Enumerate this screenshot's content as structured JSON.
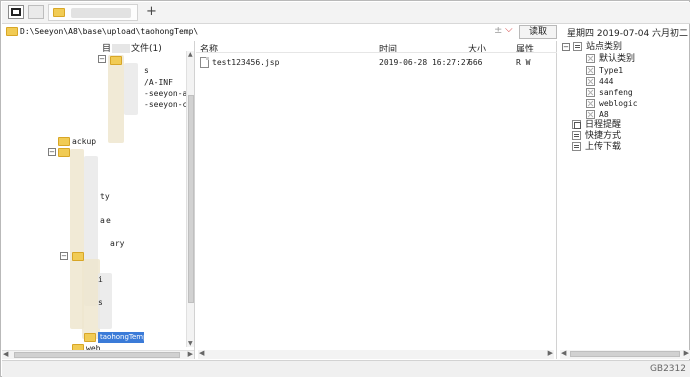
{
  "tabbar": {
    "add_label": "+"
  },
  "address": {
    "path": "D:\\Seeyon\\A8\\base\\upload\\taohongTemp\\",
    "plus": "±",
    "read_button": "读取"
  },
  "datebar": {
    "text": "星期四  2019-07-04  六月初二"
  },
  "tree": {
    "header": {
      "prefix": "目",
      "suffix": "文件(1)"
    },
    "labels": {
      "n1": "s",
      "n2": "/A-INF",
      "n3": "-seeyon-apps-",
      "n4": "-seeyon-ctp-f",
      "n5": "ackup",
      "n6": "ty",
      "n7": "a",
      "n8": "e",
      "n9": "ary",
      "n10": "i",
      "n11": "s",
      "selected": "taohongTemp",
      "last": "web"
    }
  },
  "files": {
    "headers": {
      "name": "名称",
      "time": "时间",
      "size": "大小",
      "attr": "属性"
    },
    "rows": [
      {
        "name": "test123456.jsp",
        "time": "2019-06-28 16:27:27",
        "size": "666",
        "attr": "R W"
      }
    ]
  },
  "right": {
    "root": "站点类别",
    "children": [
      "默认类别",
      "Type1",
      "444",
      "sanfeng",
      "weblogic",
      "A8"
    ],
    "schedule": "日程提醒",
    "shortcut": "快捷方式",
    "upload": "上传下载"
  },
  "status": {
    "encoding": "GB2312"
  },
  "colors": {
    "folder": "#f1cb54",
    "selection": "#3b7bd8",
    "dropdown_arrow": "#d23b3b"
  }
}
